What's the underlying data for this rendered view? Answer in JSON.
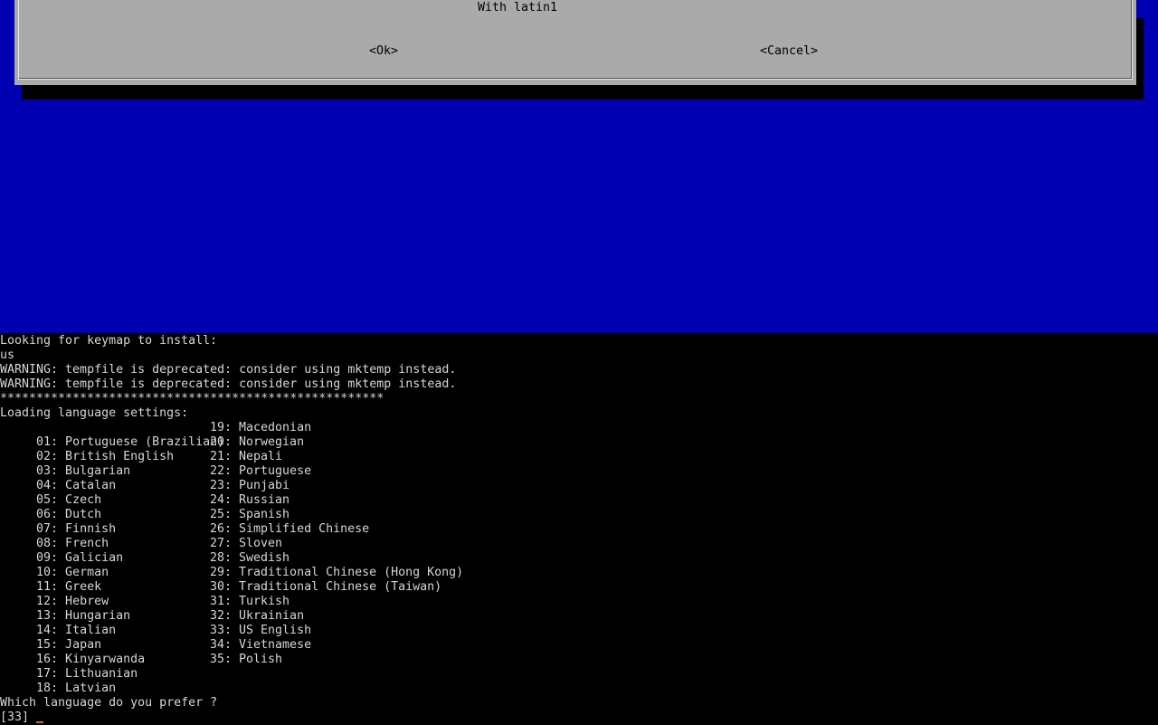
{
  "dialog": {
    "option_text": "With latin1",
    "ok_label": "<Ok>",
    "cancel_label": "<Cancel>"
  },
  "terminal": {
    "log": [
      "Looking for keymap to install:",
      "us",
      "WARNING: tempfile is deprecated: consider using mktemp instead.",
      "WARNING: tempfile is deprecated: consider using mktemp instead.",
      "*****************************************************",
      "Loading language settings:"
    ],
    "languages_left": [
      " 01: Portuguese (Brazilian)",
      " 02: British English",
      " 03: Bulgarian",
      " 04: Catalan",
      " 05: Czech",
      " 06: Dutch",
      " 07: Finnish",
      " 08: French",
      " 09: Galician",
      " 10: German",
      " 11: Greek",
      " 12: Hebrew",
      " 13: Hungarian",
      " 14: Italian",
      " 15: Japan",
      " 16: Kinyarwanda",
      " 17: Lithuanian",
      " 18: Latvian"
    ],
    "languages_right": [
      "19: Macedonian",
      "20: Norwegian",
      "21: Nepali",
      "22: Portuguese",
      "23: Punjabi",
      "24: Russian",
      "25: Spanish",
      "26: Simplified Chinese",
      "27: Sloven",
      "28: Swedish",
      "29: Traditional Chinese (Hong Kong)",
      "30: Traditional Chinese (Taiwan)",
      "31: Turkish",
      "32: Ukrainian",
      "33: US English",
      "34: Vietnamese",
      "35: Polish"
    ],
    "prompt": "Which language do you prefer ?",
    "default_value": "[33]"
  },
  "colors": {
    "background_blue": "#0000b2",
    "dialog_gray": "#aaaaaa",
    "terminal_text": "#d6d6d6",
    "cursor": "#c07030"
  }
}
